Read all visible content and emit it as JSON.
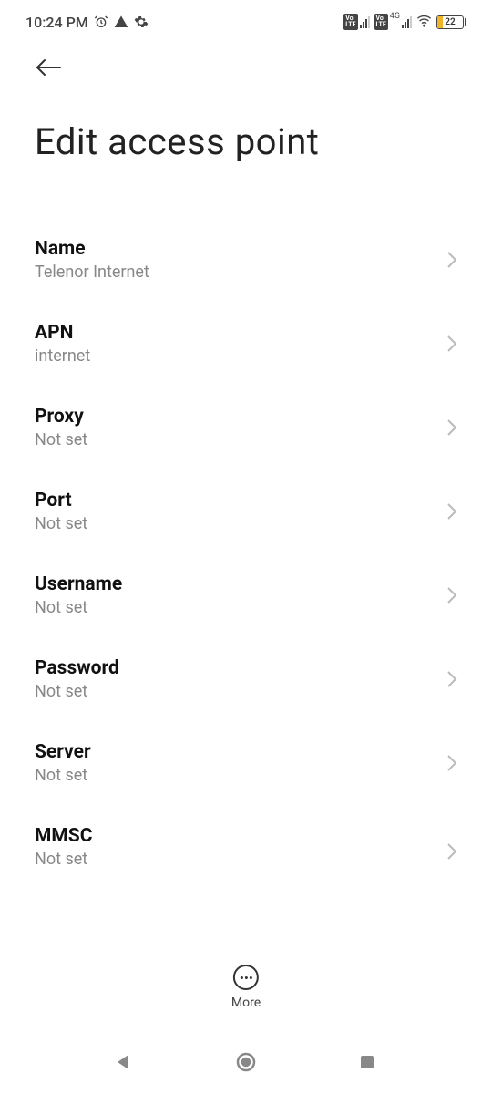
{
  "statusBar": {
    "time": "10:24 PM",
    "netLabel": "4G",
    "batteryPct": "22",
    "batteryFillPct": 22
  },
  "header": {
    "pageTitle": "Edit access point"
  },
  "settings": {
    "items": [
      {
        "title": "Name",
        "value": "Telenor Internet"
      },
      {
        "title": "APN",
        "value": "internet"
      },
      {
        "title": "Proxy",
        "value": "Not set"
      },
      {
        "title": "Port",
        "value": "Not set"
      },
      {
        "title": "Username",
        "value": "Not set"
      },
      {
        "title": "Password",
        "value": "Not set"
      },
      {
        "title": "Server",
        "value": "Not set"
      },
      {
        "title": "MMSC",
        "value": "Not set"
      }
    ]
  },
  "moreLabel": "More"
}
